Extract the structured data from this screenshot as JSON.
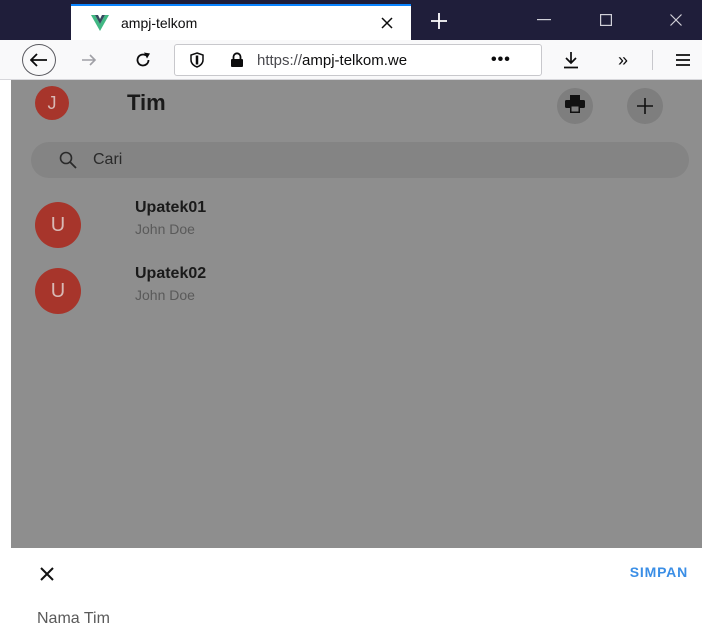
{
  "browser": {
    "tab_title": "ampj-telkom",
    "url_prefix": "https://",
    "url_domain": "ampj-telkom.we",
    "url_more": "•••",
    "overflow_glyph": "»"
  },
  "app": {
    "avatar_letter": "J",
    "title": "Tim",
    "search_placeholder": "Cari",
    "items": [
      {
        "avatar_letter": "U",
        "name": "Upatek01",
        "subtitle": "John Doe"
      },
      {
        "avatar_letter": "U",
        "name": "Upatek02",
        "subtitle": "John Doe"
      }
    ]
  },
  "sheet": {
    "save_label": "SIMPAN",
    "field_label": "Nama Tim"
  },
  "colors": {
    "accent": "#3a8ee6",
    "avatar": "#a7352b",
    "tab_accent": "#0a84ff"
  }
}
